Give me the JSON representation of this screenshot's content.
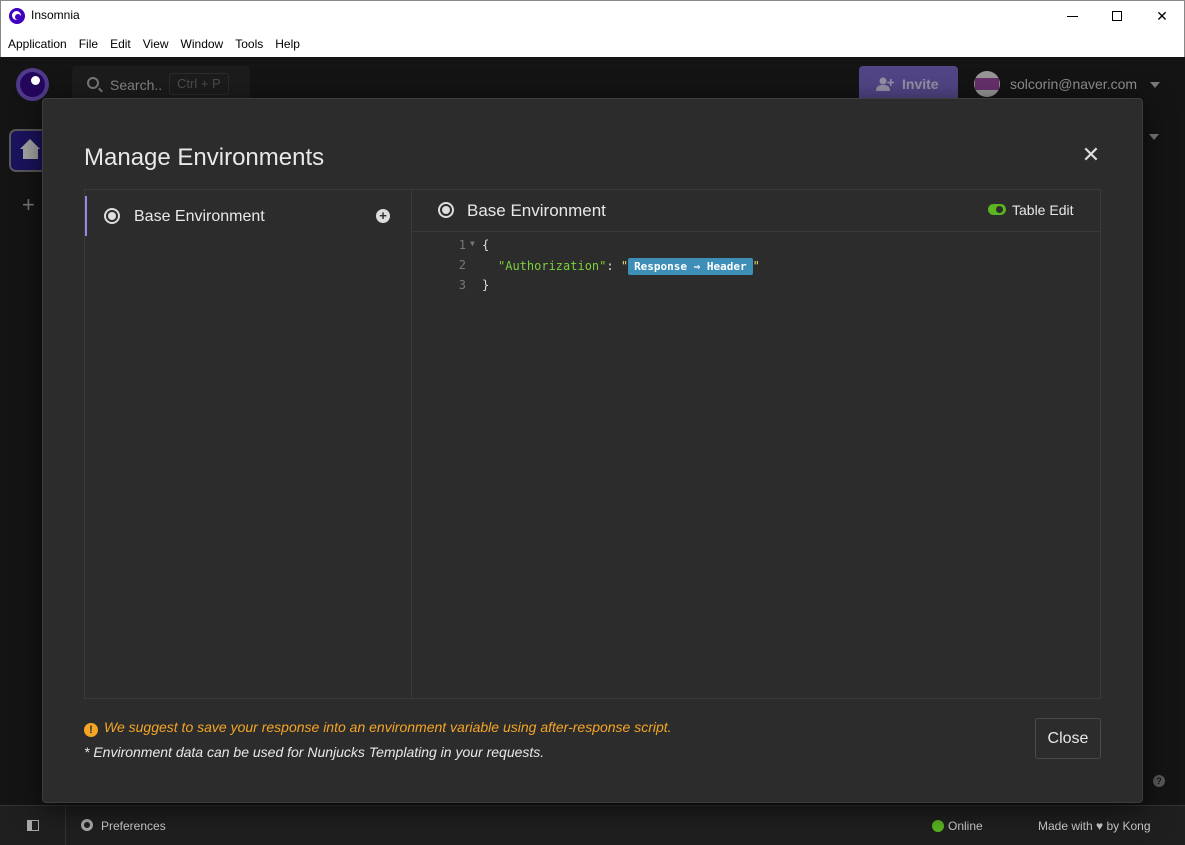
{
  "window": {
    "title": "Insomnia"
  },
  "menu": [
    "Application",
    "File",
    "Edit",
    "View",
    "Window",
    "Tools",
    "Help"
  ],
  "header": {
    "search_placeholder": "Search..",
    "search_shortcut": "Ctrl + P",
    "invite_label": "Invite",
    "user_email": "solcorin@naver.com"
  },
  "modal": {
    "title": "Manage Environments",
    "list": [
      {
        "label": "Base Environment",
        "selected": true
      }
    ],
    "editor": {
      "title": "Base Environment",
      "table_edit_label": "Table Edit",
      "lines": [
        {
          "n": "1",
          "open": "{"
        },
        {
          "n": "2",
          "key": "\"Authorization\"",
          "sep": ": ",
          "quote": "\"",
          "tag": "Response ⇒ Header"
        },
        {
          "n": "3",
          "close": "}"
        }
      ]
    },
    "warning": "We suggest to save your response into an environment variable using after-response script.",
    "note": "* Environment data can be used for Nunjucks Templating in your requests.",
    "close_label": "Close"
  },
  "statusbar": {
    "preferences": "Preferences",
    "online": "Online",
    "made_with": "Made with ♥ by Kong"
  },
  "colors": {
    "accent": "#7e6bce",
    "online": "#5ab520",
    "warning": "#f4a526",
    "tag": "#3d8fb8"
  }
}
